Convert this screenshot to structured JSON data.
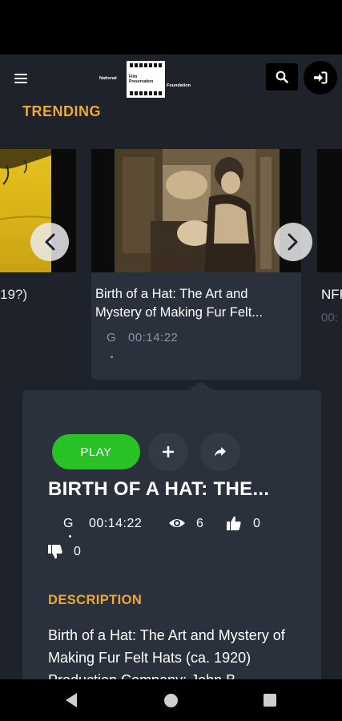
{
  "header": {
    "logo_left_text": "National",
    "logo_film_text_1": "Film",
    "logo_film_text_2": "Preservation",
    "logo_right_text": "Foundation",
    "menu_icon": "hamburger-icon",
    "search_icon": "search-icon",
    "login_icon": "sign-in-icon"
  },
  "trending": {
    "heading": "TRENDING",
    "left_card_title_fragment": "19?)",
    "main_card": {
      "title": "Birth of a Hat: The Art and Mystery of Making Fur Felt...",
      "rating": "G",
      "duration": "00:14:22"
    },
    "right_card_title_fragment": "NFF",
    "right_card_meta_fragment": "00:"
  },
  "detail": {
    "play_label": "PLAY",
    "title": "BIRTH OF A HAT: THE...",
    "rating": "G",
    "duration": "00:14:22",
    "views": "6",
    "likes": "0",
    "dislikes": "0",
    "description_heading": "DESCRIPTION",
    "description": "Birth of a Hat: The Art and Mystery of Making Fur Felt Hats (ca. 1920) Production Company: John B."
  },
  "colors": {
    "background": "#1d222b",
    "card": "#2b313c",
    "accent": "#e8a83a",
    "play": "#28c226"
  }
}
